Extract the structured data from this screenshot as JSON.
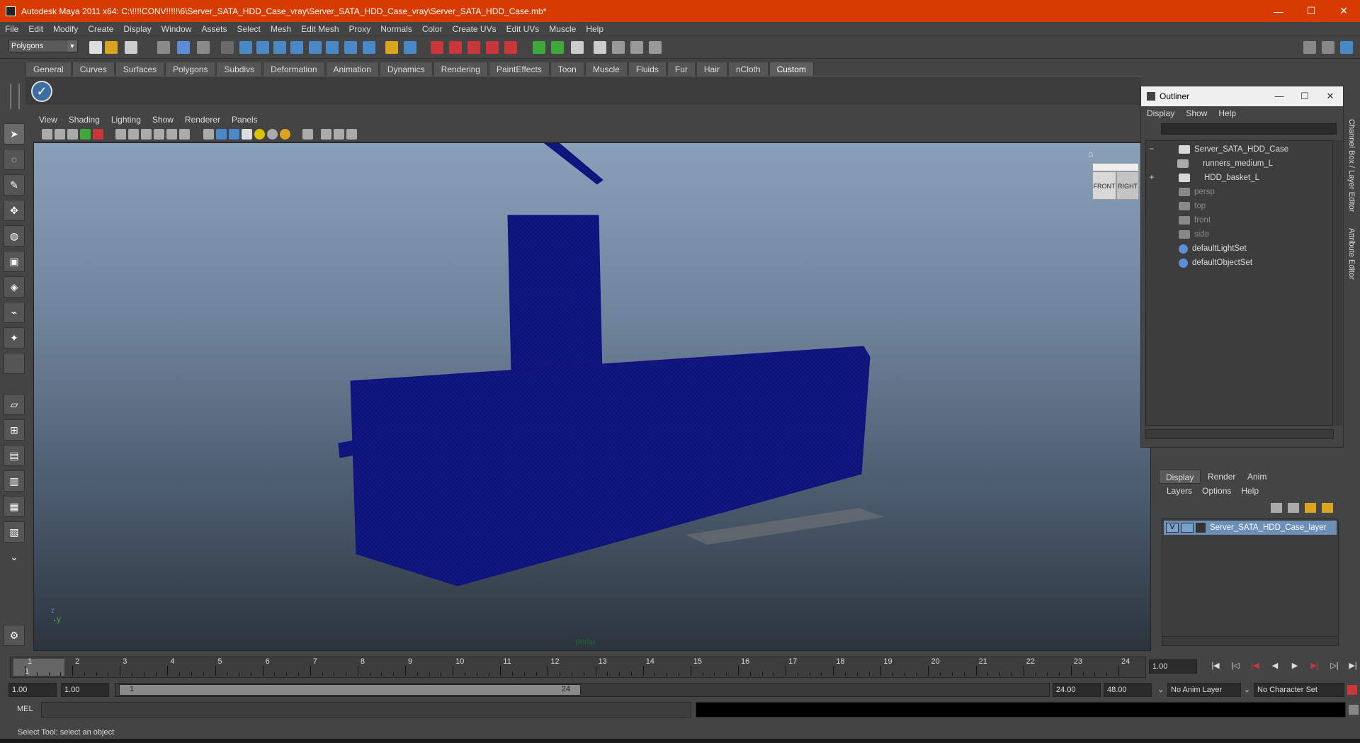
{
  "window": {
    "title": "Autodesk Maya 2011 x64: C:\\!!!!CONV!!!!!\\6\\Server_SATA_HDD_Case_vray\\Server_SATA_HDD_Case_vray\\Server_SATA_HDD_Case.mb*",
    "minimize": "—",
    "maximize": "☐",
    "close": "✕"
  },
  "menubar": [
    "File",
    "Edit",
    "Modify",
    "Create",
    "Display",
    "Window",
    "Assets",
    "Select",
    "Mesh",
    "Edit Mesh",
    "Proxy",
    "Normals",
    "Color",
    "Create UVs",
    "Edit UVs",
    "Muscle",
    "Help"
  ],
  "statusline": {
    "mode": "Polygons"
  },
  "shelf": {
    "tabs": [
      "General",
      "Curves",
      "Surfaces",
      "Polygons",
      "Subdivs",
      "Deformation",
      "Animation",
      "Dynamics",
      "Rendering",
      "PaintEffects",
      "Toon",
      "Muscle",
      "Fluids",
      "Fur",
      "Hair",
      "nCloth",
      "Custom"
    ],
    "active_tab": "Custom"
  },
  "viewport": {
    "menu": [
      "View",
      "Shading",
      "Lighting",
      "Show",
      "Renderer",
      "Panels"
    ],
    "camera_label": "persp",
    "viewcube": {
      "front": "FRONT",
      "right": "RIGHT"
    },
    "axis": {
      "y": "y",
      "z": "z"
    },
    "wire_color": "#0e137a"
  },
  "outliner": {
    "title": "Outliner",
    "menu": [
      "Display",
      "Show",
      "Help"
    ],
    "items": [
      {
        "label": "Server_SATA_HDD_Case",
        "expander": "−",
        "dim": false
      },
      {
        "label": "runners_medium_L",
        "expander": "",
        "dim": false
      },
      {
        "label": "HDD_basket_L",
        "expander": "+",
        "dim": false
      },
      {
        "label": "persp",
        "expander": "",
        "dim": true
      },
      {
        "label": "top",
        "expander": "",
        "dim": true
      },
      {
        "label": "front",
        "expander": "",
        "dim": true
      },
      {
        "label": "side",
        "expander": "",
        "dim": true
      },
      {
        "label": "defaultLightSet",
        "expander": "",
        "dim": false
      },
      {
        "label": "defaultObjectSet",
        "expander": "",
        "dim": false
      }
    ]
  },
  "side_tabs": {
    "channel_box": "Channel Box / Layer Editor",
    "attribute_editor": "Attribute Editor"
  },
  "layer_editor": {
    "tabs": [
      "Display",
      "Render",
      "Anim"
    ],
    "active_tab": "Display",
    "menu": [
      "Layers",
      "Options",
      "Help"
    ],
    "layers": [
      {
        "visible": "V",
        "name": "Server_SATA_HDD_Case_layer"
      }
    ]
  },
  "timeline": {
    "ticks": [
      "1",
      "2",
      "3",
      "4",
      "5",
      "6",
      "7",
      "8",
      "9",
      "10",
      "11",
      "12",
      "13",
      "14",
      "15",
      "16",
      "17",
      "18",
      "19",
      "20",
      "21",
      "22",
      "23",
      "24"
    ],
    "current_frame": "1",
    "current_time_field": "1.00"
  },
  "range": {
    "start": "1.00",
    "playback_start": "1.00",
    "slider_start": "1",
    "slider_end": "24",
    "playback_end": "24.00",
    "end": "48.00",
    "anim_layer": "No Anim Layer",
    "character_set": "No Character Set"
  },
  "command_line": {
    "label": "MEL"
  },
  "help_line": {
    "text": "Select Tool: select an object"
  }
}
